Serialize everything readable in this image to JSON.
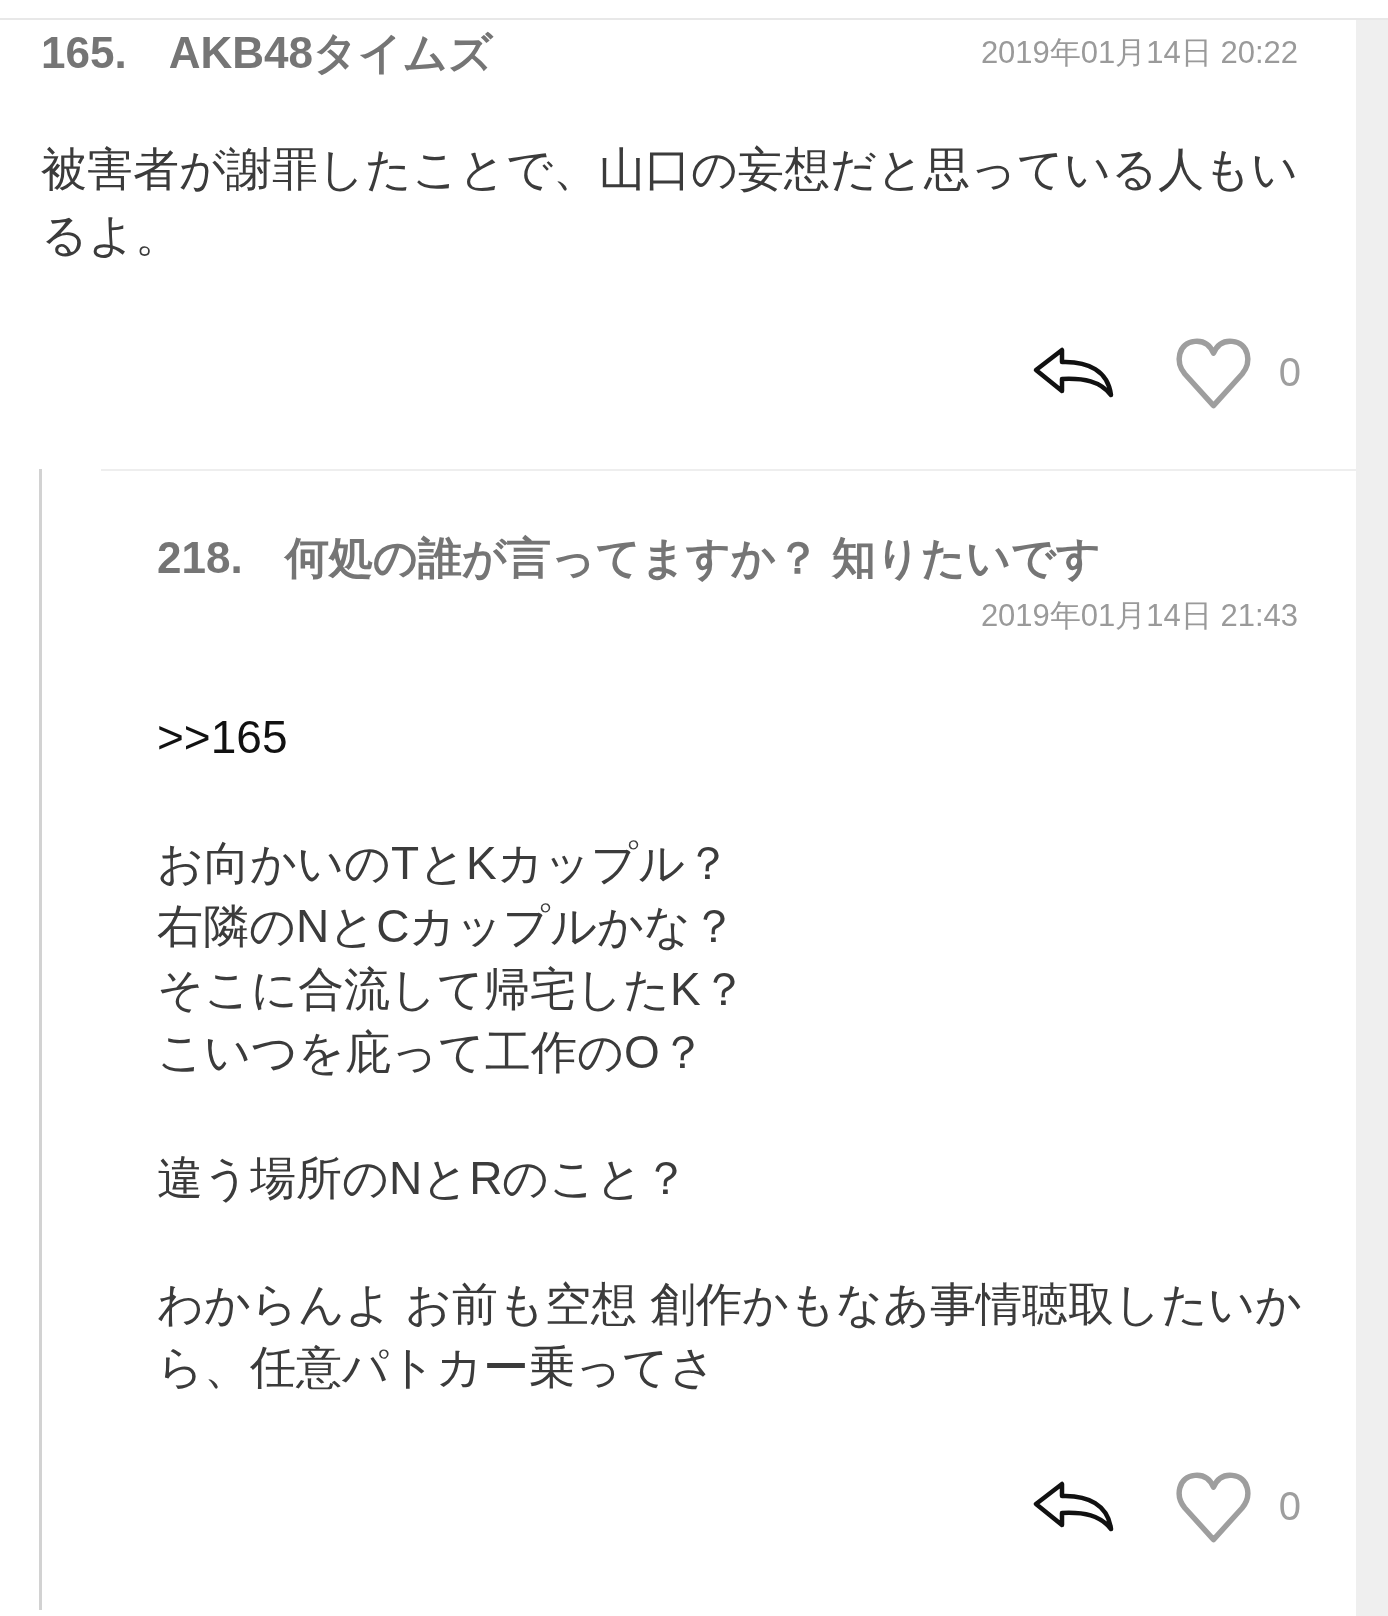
{
  "comments": [
    {
      "number": "165.",
      "title": "AKB48タイムズ",
      "date": "2019年01月14日 20:22",
      "body": [
        {
          "kind": "text",
          "text": "被害者が謝罪したことで、山口の妄想だと思っている人もいるよ。"
        }
      ],
      "like_count": "0",
      "children": [
        {
          "number": "218.",
          "title": "何処の誰が言ってますか？ 知りたいです",
          "date": "2019年01月14日 21:43",
          "body": [
            {
              "kind": "anchor",
              "text": ">>165"
            },
            {
              "kind": "lines",
              "lines": [
                "お向かいのTとKカップル？",
                "右隣のNとCカップルかな？",
                "そこに合流して帰宅したK？",
                "こいつを庇って工作のO？"
              ]
            },
            {
              "kind": "text",
              "text": "違う場所のNとRのこと？"
            },
            {
              "kind": "text",
              "text": "わからんよ お前も空想 創作かもなあ事情聴取したいから、任意パトカー乗ってさ"
            }
          ],
          "like_count": "0"
        }
      ]
    }
  ]
}
